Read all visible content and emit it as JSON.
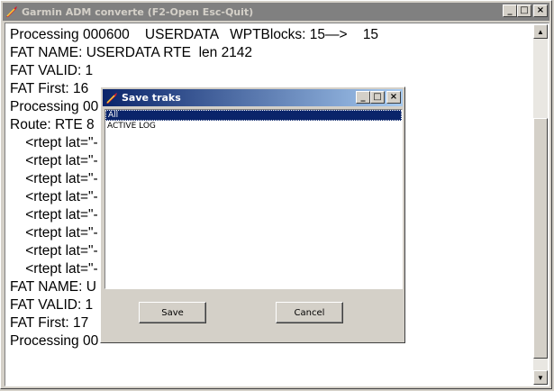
{
  "window": {
    "title": "Garmin ADM converte (F2-Open Esc-Quit)",
    "buttons": {
      "minimize": "_",
      "maximize": "□",
      "close": "×"
    }
  },
  "log_lines": [
    "Processing 000600    USERDATA   WPTBlocks: 15—>    15",
    "FAT NAME: USERDATA RTE  len 2142",
    "FAT VALID: 1",
    "FAT First: 16",
    "Processing 00",
    "Route: RTE 8",
    "    <rtept lat=\"-",
    "    <rtept lat=\"-",
    "    <rtept lat=\"-",
    "    <rtept lat=\"-",
    "    <rtept lat=\"-",
    "    <rtept lat=\"-",
    "    <rtept lat=\"-",
    "    <rtept lat=\"-",
    "FAT NAME: U",
    "FAT VALID: 1",
    "FAT First: 17",
    "Processing 00"
  ],
  "scrollbar": {
    "up": "▲",
    "down": "▼"
  },
  "dialog": {
    "title": "Save traks",
    "buttons": {
      "minimize": "_",
      "maximize": "□",
      "close": "×"
    },
    "items": [
      "All",
      "ACTIVE LOG"
    ],
    "selected_index": 0,
    "save_label": "Save",
    "cancel_label": "Cancel"
  }
}
